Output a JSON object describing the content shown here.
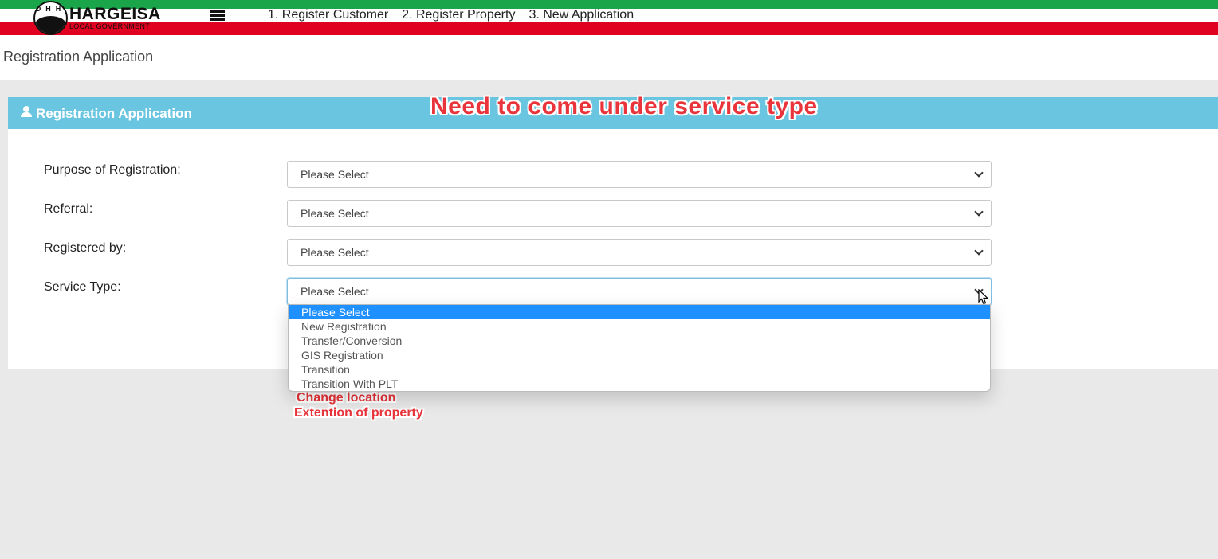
{
  "header": {
    "logo_title": "HARGEISA",
    "logo_subtitle": "LOCAL GOVERNMENT",
    "logo_seal_letters": "DHH",
    "nav": [
      "1. Register Customer",
      "2. Register Property",
      "3. New Application"
    ]
  },
  "page": {
    "title": "Registration Application"
  },
  "panel": {
    "title": "Registration Application",
    "fields": [
      {
        "label": "Purpose of Registration:",
        "value": "Please Select"
      },
      {
        "label": "Referral:",
        "value": "Please Select"
      },
      {
        "label": "Registered by:",
        "value": "Please Select"
      },
      {
        "label": "Service Type:",
        "value": "Please Select"
      }
    ]
  },
  "service_type_dropdown": {
    "options": [
      "Please Select",
      "New Registration",
      "Transfer/Conversion",
      "GIS Registration",
      "Transition",
      "Transition With PLT"
    ],
    "selected": "Please Select"
  },
  "annotations": {
    "top": "Need to come under service type",
    "line1": "Change location",
    "line2": "Extention of property"
  },
  "colors": {
    "stripe_green": "#1aa54a",
    "stripe_red": "#e0001f",
    "panel_header": "#6ac5e0",
    "dropdown_selected": "#1e90ff",
    "annotation": "#e8343a"
  }
}
